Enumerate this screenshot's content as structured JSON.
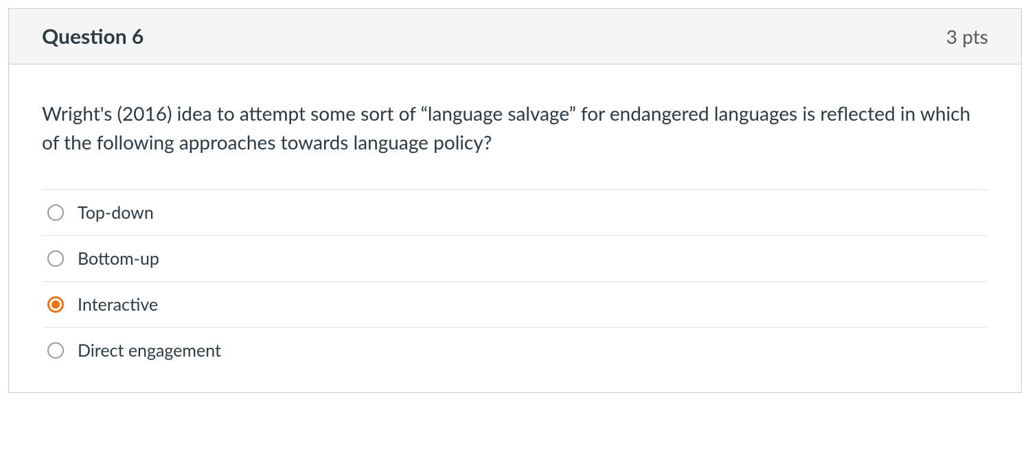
{
  "question": {
    "title": "Question 6",
    "points": "3 pts",
    "text": "Wright's (2016) idea to attempt some sort of “language salvage” for endangered languages is reflected in which of the following approaches towards language policy?",
    "selectedIndex": 2,
    "answers": [
      {
        "label": "Top-down"
      },
      {
        "label": "Bottom-up"
      },
      {
        "label": "Interactive"
      },
      {
        "label": "Direct engagement"
      }
    ]
  }
}
